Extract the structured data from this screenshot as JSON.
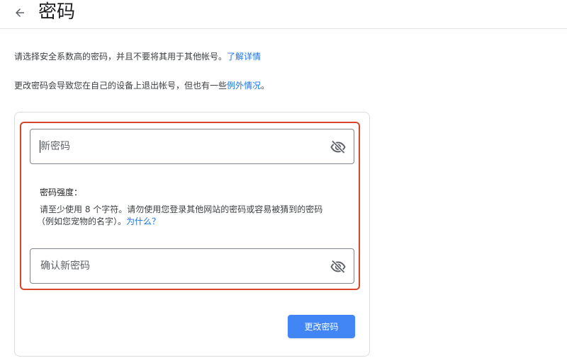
{
  "header": {
    "title": "密码",
    "back_icon": "arrow-left-icon"
  },
  "intro": {
    "text1": "请选择安全系数高的密码，并且不要将其用于其他帐号。",
    "link1": "了解详情",
    "text2": "更改密码会导致您在自己的设备上退出帐号，但也有一些",
    "link2": "例外情况",
    "text2_end": "。"
  },
  "form": {
    "new_password": {
      "placeholder": "新密码",
      "value": "",
      "visibility_icon": "eye-off-icon"
    },
    "strength_label": "密码强度：",
    "hint_line1": "请至少使用 8 个字符。请勿使用您登录其他网站的密码或容易被猜到的密码",
    "hint_line2": "（例如您宠物的名字）。",
    "hint_link": "为什么？",
    "confirm_password": {
      "placeholder": "确认新密码",
      "value": "",
      "visibility_icon": "eye-off-icon"
    },
    "submit_label": "更改密码"
  },
  "colors": {
    "accent": "#1a73e8",
    "button": "#4285f4",
    "highlight": "#d9452b"
  }
}
